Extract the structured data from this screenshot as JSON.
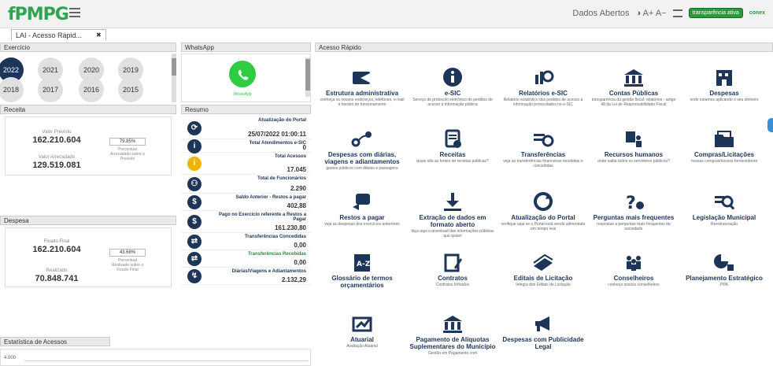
{
  "header": {
    "logo": "fPMPG",
    "dados": "Dados Abertos",
    "font_ctrl": "◑ A+ A−",
    "badge": "transparência ativa",
    "badge2": "conex"
  },
  "tab": {
    "label": "LAI - Acesso Rápid...",
    "close": "✖"
  },
  "exercicio": {
    "title": "Exercício",
    "years": [
      "2022",
      "2021",
      "2020",
      "2019",
      "2018",
      "2017",
      "2016",
      "2015"
    ]
  },
  "whatsapp": {
    "title": "WhatsApp",
    "label": "WhatsApp"
  },
  "resumo": {
    "title": "Resumo",
    "rows": [
      {
        "t": "Atualização do Portal",
        "v": "25/07/2022 01:00:11",
        "icon": "sync"
      },
      {
        "t": "Total Atendimentos e-SIC",
        "v": "0",
        "icon": "i"
      },
      {
        "t": "Total Acessos",
        "v": "17.045",
        "icon": "i"
      },
      {
        "t": "Total de Funcionários",
        "v": "2.290",
        "icon": "people"
      },
      {
        "t": "Saldo Anterior - Restos a pagar",
        "v": "402,88",
        "icon": "rs"
      },
      {
        "t": "Pago no Exercício referente a Restos a Pagar",
        "v": "161.230,80",
        "icon": "rs"
      },
      {
        "t": "Transferências Concedidas",
        "v": "0,00",
        "icon": "transfer"
      },
      {
        "t": "Transferências Recebidas",
        "v": "0,00",
        "icon": "transfer"
      },
      {
        "t": "Diárias/Viagens e Adiantamentos",
        "v": "2.132,29",
        "icon": "route"
      }
    ]
  },
  "receita": {
    "title": "Receita",
    "prev_lbl": "Valor Previsto",
    "prev": "162.210.604",
    "arr_lbl": "Valor Arrecadado",
    "arr": "129.519.081",
    "pct": "79.85%",
    "pct_cap": "Percentual Arrecadado sobre o Previsto"
  },
  "despesa": {
    "title": "Despesa",
    "fix_lbl": "Fixado Final",
    "fix": "162.210.604",
    "real_lbl": "Realizado",
    "real": "70.848.741",
    "pct": "43.68%",
    "pct_cap": "Percentual Realizado sobre o Fixado Final"
  },
  "estat": {
    "title": "Estatística de Acessos",
    "ytick": "4.000"
  },
  "acesso": {
    "title": "Acesso Rápido",
    "tiles": [
      {
        "t": "Estrutura administrativa",
        "s": "conheça os nossos endereços, telefones, e-mail e horário de funcionamento"
      },
      {
        "t": "e-SIC",
        "s": "Serviço de protocolo eletrônico de pedidos de acesso à informação pública"
      },
      {
        "t": "Relatórios e-SIC",
        "s": "Relatório estatístico dos pedidos de acesso à informação protocolados no e-SIC"
      },
      {
        "t": "Contas Públicas",
        "s": "transparência da gestão fiscal: relatórios - artigo 48 da Lei de Responsabilidade Fiscal"
      },
      {
        "t": "Despesas",
        "s": "onde estamos aplicando o seu dinheiro"
      },
      {
        "t": "Despesas com diárias, viagens e adiantamentos",
        "s": "gastos públicos com diárias e passagens"
      },
      {
        "t": "Receitas",
        "s": "quais são as fontes de receitas públicas?"
      },
      {
        "t": "Transferências",
        "s": "veja as transferências financeiras recebidas e concedidas"
      },
      {
        "t": "Recursos humanos",
        "s": "onde saiba todos os servidores públicos?"
      },
      {
        "t": "Compras/Licitações",
        "s": "nossas compras/nossos fornecedores"
      },
      {
        "t": "Restos a pagar",
        "s": "veja as despesas dos exercícios anteriores"
      },
      {
        "t": "Extração de dados em formato aberto",
        "s": "faça aqui o download das informações públicas que quiser"
      },
      {
        "t": "Atualização do Portal",
        "s": "verifique aqui se o Portal está sendo alimentado em tempo real"
      },
      {
        "t": "Perguntas mais frequentes",
        "s": "respostas a perguntas mais frequentes da sociedade"
      },
      {
        "t": "Legislação Municipal",
        "s": "Reestruturação"
      },
      {
        "t": "Glossário de termos orçamentários",
        "s": ""
      },
      {
        "t": "Contratos",
        "s": "Contratos firmados"
      },
      {
        "t": "Editais de Licitação",
        "s": "Íntegra dos Editais de Licitação"
      },
      {
        "t": "Conselheiros",
        "s": "conheça nossos conselheiros"
      },
      {
        "t": "Planejamento Estratégico",
        "s": "PPA"
      },
      {
        "t": "Atuarial",
        "s": "Avaliação Atuarial"
      },
      {
        "t": "Pagamento de Alíquotas Suplementares do Município",
        "s": "Gestão em Pagamento com"
      },
      {
        "t": "Despesas com Publicidade Legal",
        "s": ""
      }
    ]
  },
  "colors": {
    "navy": "#1c3559",
    "green": "#2ea44f"
  }
}
